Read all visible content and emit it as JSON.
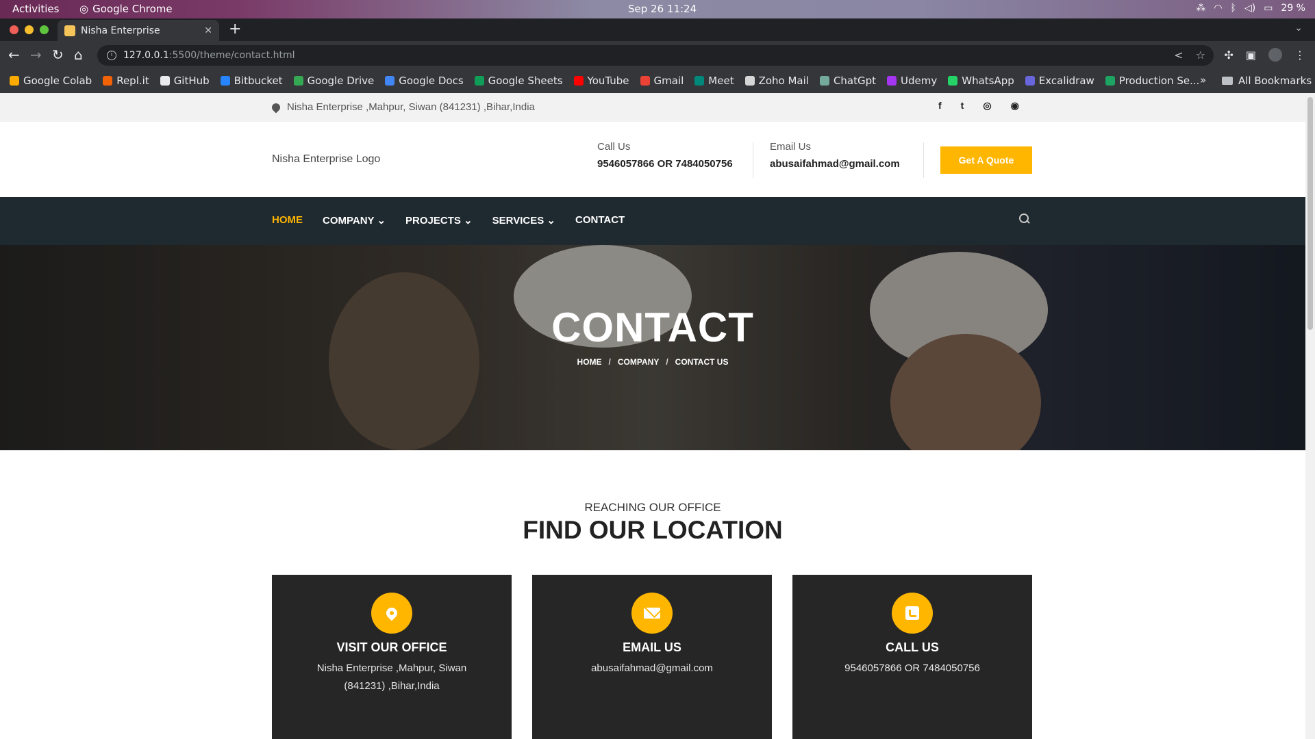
{
  "os": {
    "activities": "Activities",
    "app_name": "Google Chrome",
    "clock": "Sep 26  11:24",
    "battery": "29 %"
  },
  "browser": {
    "tab_title": "Nisha Enterprise",
    "url_host": "127.0.0.1",
    "url_path": ":5500/theme/contact.html",
    "bookmarks": [
      {
        "label": "Google Colab",
        "color": "#f9ab00"
      },
      {
        "label": "Repl.it",
        "color": "#f26207"
      },
      {
        "label": "GitHub",
        "color": "#e8eaed"
      },
      {
        "label": "Bitbucket",
        "color": "#2684ff"
      },
      {
        "label": "Google Drive",
        "color": "#34a853"
      },
      {
        "label": "Google Docs",
        "color": "#4285f4"
      },
      {
        "label": "Google Sheets",
        "color": "#0f9d58"
      },
      {
        "label": "YouTube",
        "color": "#ff0000"
      },
      {
        "label": "Gmail",
        "color": "#ea4335"
      },
      {
        "label": "Meet",
        "color": "#00897b"
      },
      {
        "label": "Zoho Mail",
        "color": "#d6d6d6"
      },
      {
        "label": "ChatGpt",
        "color": "#74aa9c"
      },
      {
        "label": "Udemy",
        "color": "#a435f0"
      },
      {
        "label": "WhatsApp",
        "color": "#25d366"
      },
      {
        "label": "Excalidraw",
        "color": "#6965db"
      },
      {
        "label": "Production Se...",
        "color": "#1da462"
      }
    ],
    "bookmarks_more": "»",
    "all_bookmarks": "All Bookmarks"
  },
  "site": {
    "topbar_location": "Nisha Enterprise ,Mahpur, Siwan (841231) ,Bihar,India",
    "logo_text": "Nisha Enterprise Logo",
    "call_label": "Call Us",
    "call_value": "9546057866 OR 7484050756",
    "email_label": "Email Us",
    "email_value": "abusaifahmad@gmail.com",
    "quote_button": "Get A Quote",
    "nav": [
      "HOME",
      "COMPANY",
      "PROJECTS",
      "SERVICES",
      "CONTACT"
    ],
    "hero_title": "CONTACT",
    "breadcrumb": [
      "HOME",
      "COMPANY",
      "CONTACT US"
    ],
    "breadcrumb_sep": "/",
    "section_subtitle": "REACHING OUR OFFICE",
    "section_title": "FIND OUR LOCATION",
    "cards": [
      {
        "title": "VISIT OUR OFFICE",
        "text": "Nisha Enterprise ,Mahpur, Siwan (841231) ,Bihar,India"
      },
      {
        "title": "EMAIL US",
        "text": "abusaifahmad@gmail.com"
      },
      {
        "title": "CALL US",
        "text": "9546057866 OR 7484050756"
      }
    ],
    "accent_color": "#ffb600",
    "nav_bg": "#1f2930"
  }
}
